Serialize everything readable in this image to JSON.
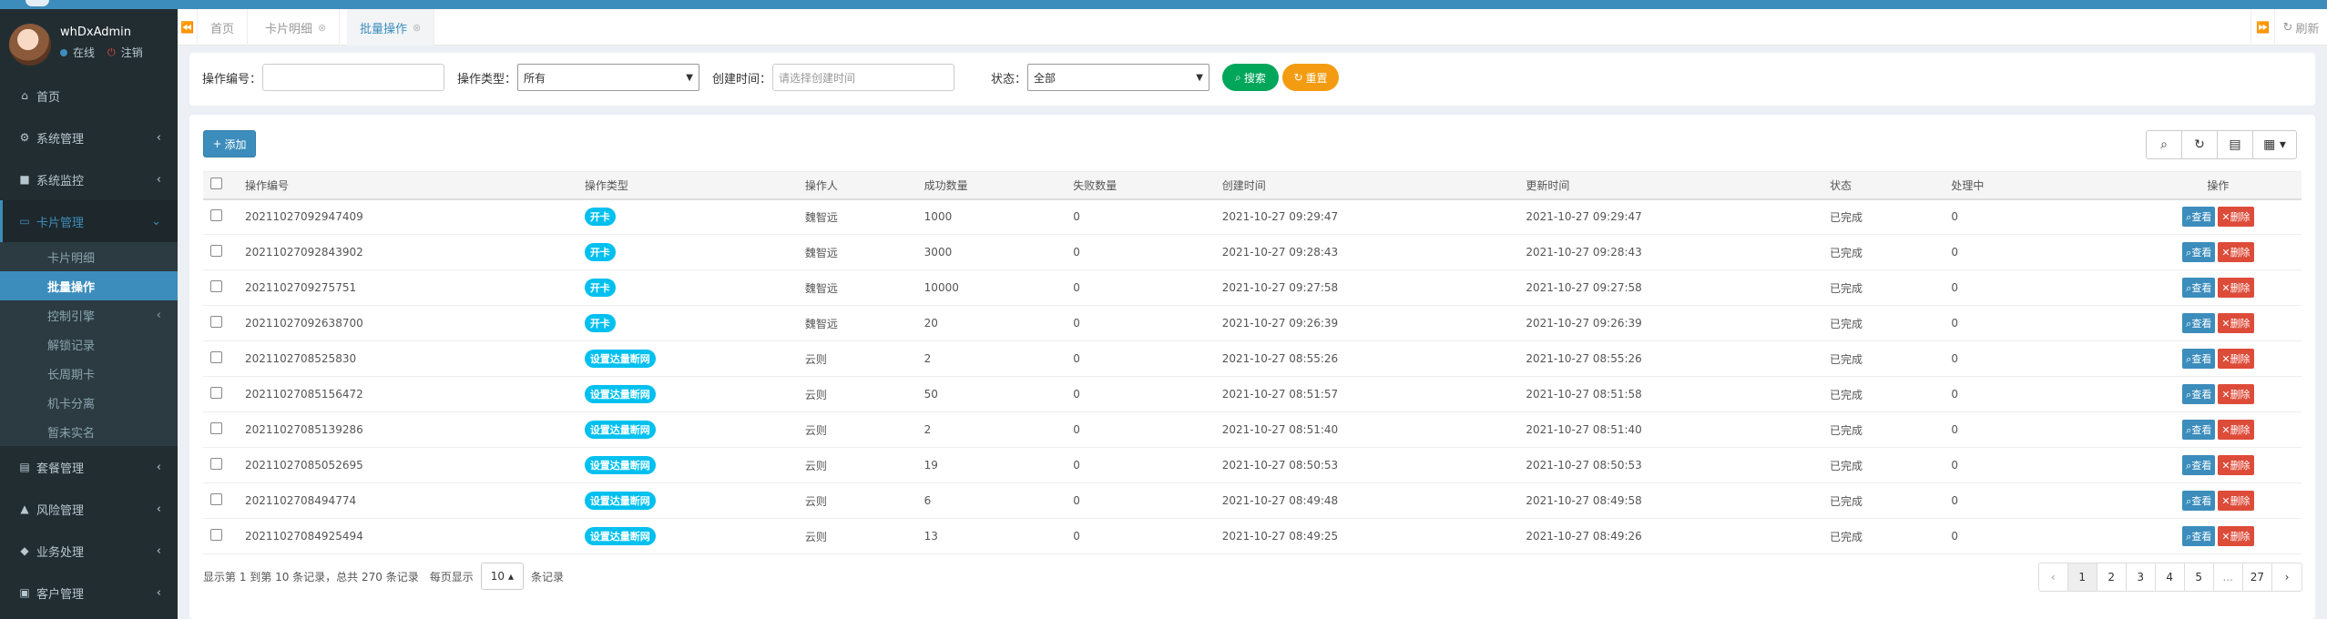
{
  "user": {
    "name": "whDxAdmin",
    "status": "在线",
    "logout": "注销"
  },
  "sidebar": {
    "items": [
      {
        "label": "首页",
        "icon": "home-icon",
        "glyph": "⌂"
      },
      {
        "label": "系统管理",
        "icon": "gear-icon",
        "glyph": "⚙"
      },
      {
        "label": "系统监控",
        "icon": "video-camera-icon",
        "glyph": "■"
      },
      {
        "label": "卡片管理",
        "icon": "credit-card-icon",
        "glyph": "▭"
      }
    ],
    "subitems": [
      "卡片明细",
      "批量操作",
      "控制引擎",
      "解锁记录",
      "长周期卡",
      "机卡分离",
      "暂未实名"
    ],
    "items_bottom": [
      {
        "label": "套餐管理",
        "icon": "bar-chart-icon",
        "glyph": "▤"
      },
      {
        "label": "风险管理",
        "icon": "warning-icon",
        "glyph": "▲"
      },
      {
        "label": "业务处理",
        "icon": "layers-icon",
        "glyph": "◆"
      },
      {
        "label": "客户管理",
        "icon": "user-card-icon",
        "glyph": "▣"
      }
    ]
  },
  "tabs": {
    "home": "首页",
    "card_detail": "卡片明细",
    "batch": "批量操作",
    "refresh": "刷新"
  },
  "search": {
    "op_no_label": "操作编号：",
    "op_type_label": "操作类型：",
    "op_type_value": "所有",
    "created_label": "创建时间：",
    "created_placeholder": "请选择创建时间",
    "status_label": "状态：",
    "status_value": "全部",
    "search_btn": "搜索",
    "reset_btn": "重置"
  },
  "toolbar": {
    "add": "添加"
  },
  "table": {
    "columns": [
      "操作编号",
      "操作类型",
      "操作人",
      "成功数量",
      "失败数量",
      "创建时间",
      "更新时间",
      "状态",
      "处理中",
      "操作"
    ],
    "rows": [
      [
        "20211027092947409",
        "开卡",
        "魏智远",
        "1000",
        "0",
        "2021-10-27 09:29:47",
        "2021-10-27 09:29:47",
        "已完成",
        "0"
      ],
      [
        "20211027092843902",
        "开卡",
        "魏智远",
        "3000",
        "0",
        "2021-10-27 09:28:43",
        "2021-10-27 09:28:43",
        "已完成",
        "0"
      ],
      [
        "2021102709275751",
        "开卡",
        "魏智远",
        "10000",
        "0",
        "2021-10-27 09:27:58",
        "2021-10-27 09:27:58",
        "已完成",
        "0"
      ],
      [
        "20211027092638700",
        "开卡",
        "魏智远",
        "20",
        "0",
        "2021-10-27 09:26:39",
        "2021-10-27 09:26:39",
        "已完成",
        "0"
      ],
      [
        "2021102708525830",
        "设置达量断网",
        "云则",
        "2",
        "0",
        "2021-10-27 08:55:26",
        "2021-10-27 08:55:26",
        "已完成",
        "0"
      ],
      [
        "2021102708515647​2",
        "设置达量断网",
        "云则",
        "50",
        "0",
        "2021-10-27 08:51:57",
        "2021-10-27 08:51:58",
        "已完成",
        "0"
      ],
      [
        "20211027085139286",
        "设置达量断网",
        "云则",
        "2",
        "0",
        "2021-10-27 08:51:40",
        "2021-10-27 08:51:40",
        "已完成",
        "0"
      ],
      [
        "20211027085052695",
        "设置达量断网",
        "云则",
        "19",
        "0",
        "2021-10-27 08:50:53",
        "2021-10-27 08:50:53",
        "已完成",
        "0"
      ],
      [
        "2021102708494774",
        "设置达量断网",
        "云则",
        "6",
        "0",
        "2021-10-27 08:49:48",
        "2021-10-27 08:49:58",
        "已完成",
        "0"
      ],
      [
        "20211027084925494",
        "设置达量断网",
        "云则",
        "13",
        "0",
        "2021-10-27 08:49:25",
        "2021-10-27 08:49:26",
        "已完成",
        "0"
      ]
    ],
    "view_btn": "查看",
    "delete_btn": "删除"
  },
  "footer": {
    "info": "显示第 1 到第 10 条记录，总共 270 条记录",
    "per_page_prefix": "每页显示",
    "per_page_value": "10",
    "per_page_suffix": "条记录"
  },
  "pagination": [
    "‹",
    "1",
    "2",
    "3",
    "4",
    "5",
    "...",
    "27",
    "›"
  ],
  "colors": {
    "primary": "#3c8dbc",
    "sidebar": "#222d32",
    "success": "#00a65a",
    "warning": "#f39c12",
    "danger": "#dd4b39",
    "info": "#00c0ef"
  }
}
